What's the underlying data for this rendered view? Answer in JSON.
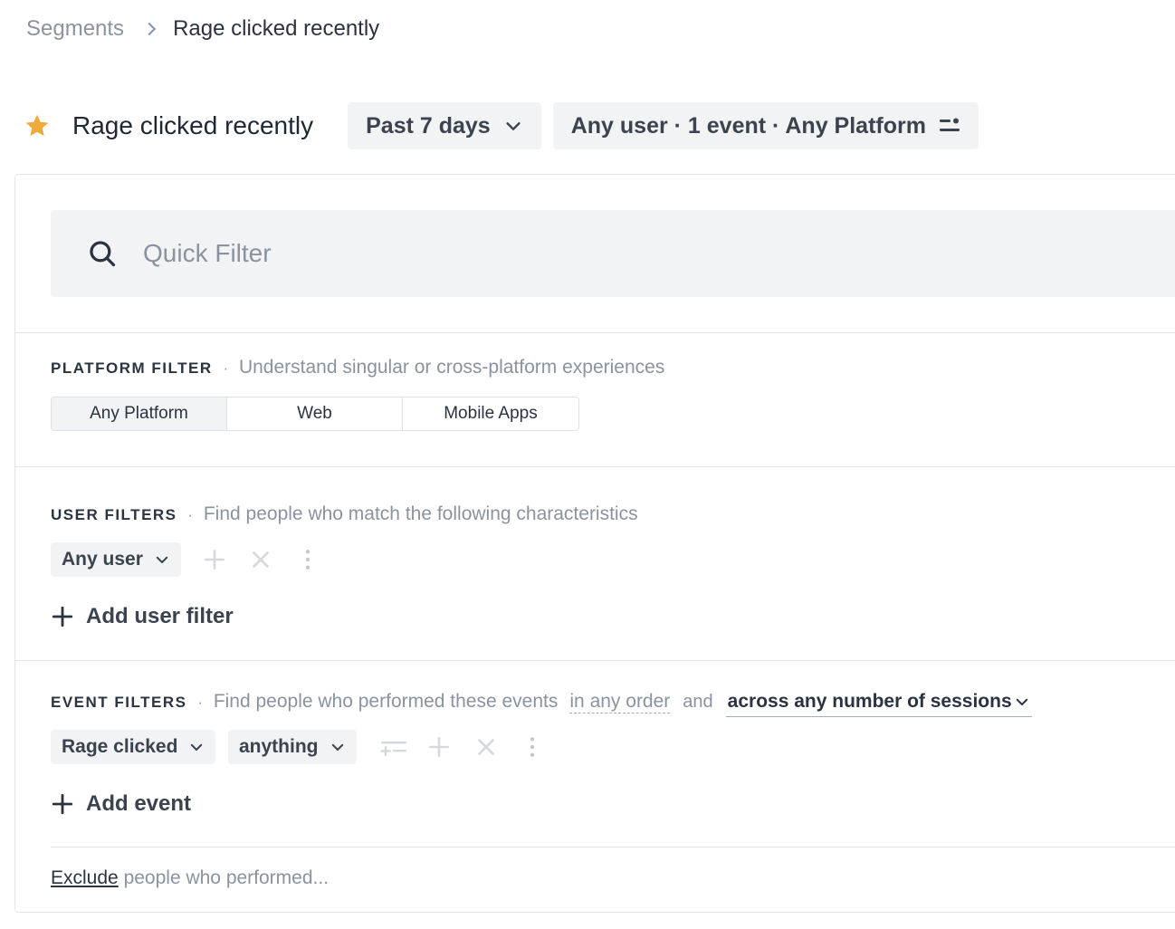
{
  "breadcrumb": {
    "root": "Segments",
    "current": "Rage clicked recently"
  },
  "header": {
    "title": "Rage clicked recently",
    "date_range": "Past 7 days",
    "summary": "Any user · 1 event · Any Platform"
  },
  "quick_filter": {
    "placeholder": "Quick Filter"
  },
  "platform_filter": {
    "title": "PLATFORM FILTER",
    "description": "Understand singular or cross-platform experiences",
    "options": [
      "Any Platform",
      "Web",
      "Mobile Apps"
    ],
    "selected": "Any Platform"
  },
  "user_filters": {
    "title": "USER FILTERS",
    "description": "Find people who match the following characteristics",
    "chip": "Any user",
    "add_label": "Add user filter"
  },
  "event_filters": {
    "title": "EVENT FILTERS",
    "description": "Find people who performed these events",
    "order": "in any order",
    "and": "and",
    "sessions": "across any number of sessions",
    "event_chip": "Rage clicked",
    "value_chip": "anything",
    "add_label": "Add event"
  },
  "exclude": {
    "link": "Exclude",
    "rest": "people who performed..."
  },
  "colors": {
    "star": "#f0a93a",
    "pill_bg": "#f2f3f4",
    "muted_text": "#8a939e",
    "text": "#2b3340"
  }
}
